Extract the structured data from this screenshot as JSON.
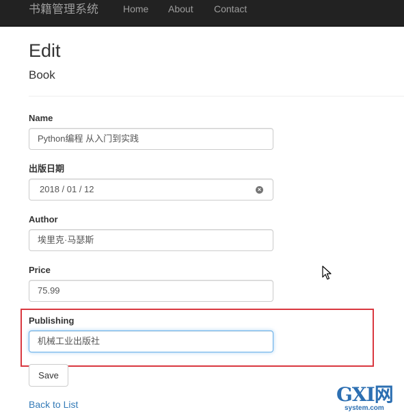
{
  "navbar": {
    "brand": "书籍管理系统",
    "links": [
      "Home",
      "About",
      "Contact"
    ]
  },
  "page": {
    "title": "Edit",
    "subtitle": "Book"
  },
  "form": {
    "name": {
      "label": "Name",
      "value": "Python编程 从入门到实践"
    },
    "publish_date": {
      "label": "出版日期",
      "value": "2018 / 01 / 12"
    },
    "author": {
      "label": "Author",
      "value": "埃里克·马瑟斯"
    },
    "price": {
      "label": "Price",
      "value": "75.99"
    },
    "publishing": {
      "label": "Publishing",
      "value": "机械工业出版社"
    },
    "save_label": "Save"
  },
  "back_link": "Back to List",
  "watermark": {
    "main": "GXI网",
    "sub": "system.com"
  },
  "colors": {
    "navbar_bg": "#222222",
    "nav_text": "#9d9d9d",
    "link": "#337ab7",
    "highlight": "#d9363e",
    "focus": "#66afe9",
    "watermark": "#2c6fb2"
  },
  "icons": {
    "clear": "clear-date-icon",
    "cursor": "mouse-cursor-icon"
  }
}
